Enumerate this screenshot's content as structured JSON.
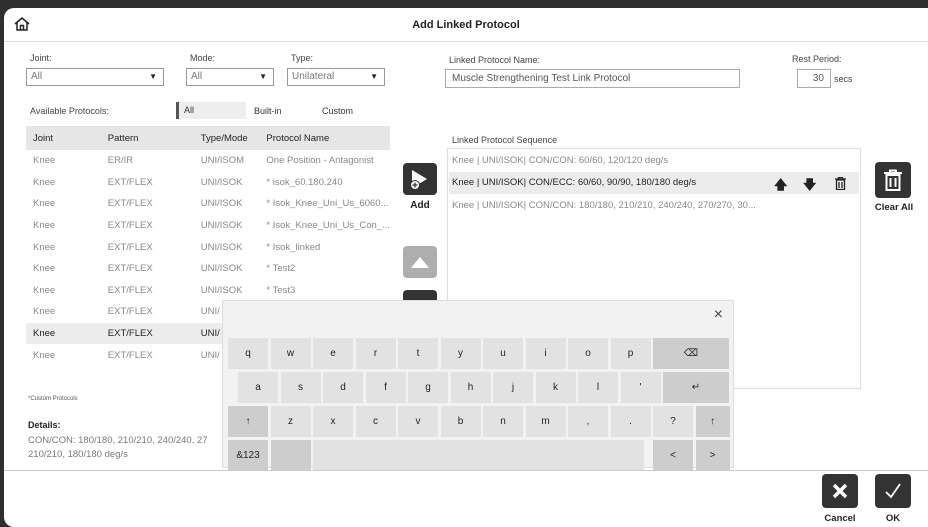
{
  "header": {
    "title": "Add Linked Protocol",
    "home_icon": "home-icon"
  },
  "filters": {
    "joint": {
      "label": "Joint:",
      "value": "All"
    },
    "mode": {
      "label": "Mode:",
      "value": "All"
    },
    "type": {
      "label": "Type:",
      "value": "Unilateral"
    }
  },
  "linked": {
    "name_label": "Linked Protocol Name:",
    "name_value": "Muscle Strengthening Test Link Protocol",
    "rest_label": "Rest Period:",
    "rest_value": "30",
    "rest_unit": "secs"
  },
  "available": {
    "label": "Available Protocols:",
    "tabs": [
      "All",
      "Built-in",
      "Custom"
    ]
  },
  "table": {
    "headers": [
      "Joint",
      "Pattern",
      "Type/Mode",
      "Protocol Name"
    ],
    "rows": [
      [
        "Knee",
        "ER/IR",
        "UNI/ISOM",
        "One Position - Antagonist"
      ],
      [
        "Knee",
        "EXT/FLEX",
        "UNI/ISOK",
        "* isok_60.180.240"
      ],
      [
        "Knee",
        "EXT/FLEX",
        "UNI/ISOK",
        "* Isok_Knee_Uni_Us_6060..."
      ],
      [
        "Knee",
        "EXT/FLEX",
        "UNI/ISOK",
        "* Isok_Knee_Uni_Us_Con_..."
      ],
      [
        "Knee",
        "EXT/FLEX",
        "UNI/ISOK",
        "* Isok_linked"
      ],
      [
        "Knee",
        "EXT/FLEX",
        "UNI/ISOK",
        "* Test2"
      ],
      [
        "Knee",
        "EXT/FLEX",
        "UNI/ISOK",
        "* Test3"
      ],
      [
        "Knee",
        "EXT/FLEX",
        "UNI/",
        ""
      ],
      [
        "Knee",
        "EXT/FLEX",
        "UNI/",
        ""
      ],
      [
        "Knee",
        "EXT/FLEX",
        "UNI/",
        ""
      ]
    ],
    "selected_row": 8,
    "footnote": "*Custom Protocols"
  },
  "details": {
    "label": "Details:",
    "line1": "CON/CON: 180/180, 210/210, 240/240, 27",
    "line2": "210/210, 180/180 deg/s"
  },
  "add_button": {
    "label": "Add"
  },
  "sequence": {
    "label": "Linked Protocol Sequence",
    "rows": [
      "Knee | UNI/ISOK| CON/CON: 60/60, 120/120 deg/s",
      "Knee | UNI/ISOK| CON/ECC: 60/60, 90/90, 180/180 deg/s",
      "Knee | UNI/ISOK| CON/CON: 180/180, 210/210, 240/240, 270/270, 30..."
    ],
    "selected": 1
  },
  "clear_all": {
    "label": "Clear All"
  },
  "keyboard": {
    "close": "×",
    "row1": [
      "q",
      "w",
      "e",
      "r",
      "t",
      "y",
      "u",
      "i",
      "o",
      "p"
    ],
    "backspace": "⌫",
    "row2": [
      "a",
      "s",
      "d",
      "f",
      "g",
      "h",
      "j",
      "k",
      "l",
      "'"
    ],
    "enter": "↵",
    "shift": "↑",
    "row3": [
      "z",
      "x",
      "c",
      "v",
      "b",
      "n",
      "m",
      ",",
      ".",
      "?"
    ],
    "symbols": "&123",
    "left": "<",
    "right": ">"
  },
  "footer": {
    "cancel": "Cancel",
    "ok": "OK"
  }
}
